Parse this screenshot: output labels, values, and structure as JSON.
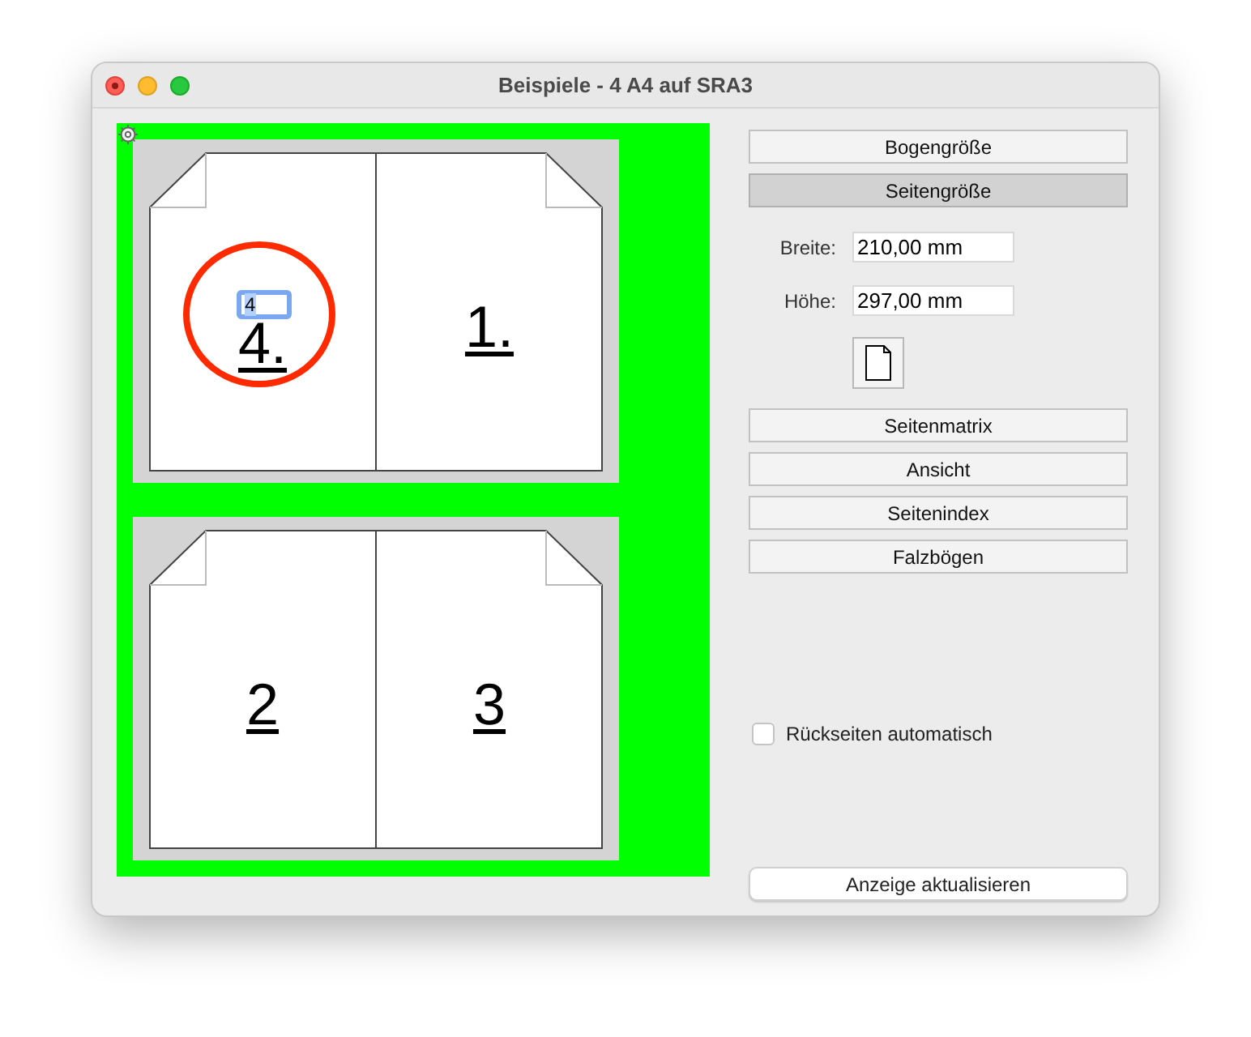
{
  "window": {
    "title": "Beispiele - 4 A4 auf SRA3"
  },
  "sheets": [
    {
      "pages": [
        {
          "number": "4.",
          "kind": "leftfold",
          "highlighted": true,
          "editor": {
            "value": "4"
          }
        },
        {
          "number": "1.",
          "kind": "rightfold",
          "highlighted": false
        }
      ]
    },
    {
      "pages": [
        {
          "number": "2",
          "kind": "leftfold",
          "highlighted": false
        },
        {
          "number": "3",
          "kind": "rightfold",
          "highlighted": false
        }
      ]
    }
  ],
  "top_tabs": [
    {
      "label": "Bogengröße",
      "selected": false
    },
    {
      "label": "Seitengröße",
      "selected": true
    }
  ],
  "size_fields": [
    {
      "label": "Breite:",
      "value": "210,00 mm"
    },
    {
      "label": "Höhe:",
      "value": "297,00 mm"
    }
  ],
  "sections": [
    {
      "label": "Seitenmatrix",
      "selected": false
    },
    {
      "label": "Ansicht",
      "selected": false
    },
    {
      "label": "Seitenindex",
      "selected": false
    },
    {
      "label": "Falzbögen",
      "selected": false
    }
  ],
  "backside_checkbox": {
    "label": "Rückseiten automatisch",
    "checked": false
  },
  "update_button": {
    "label": "Anzeige aktualisieren"
  }
}
